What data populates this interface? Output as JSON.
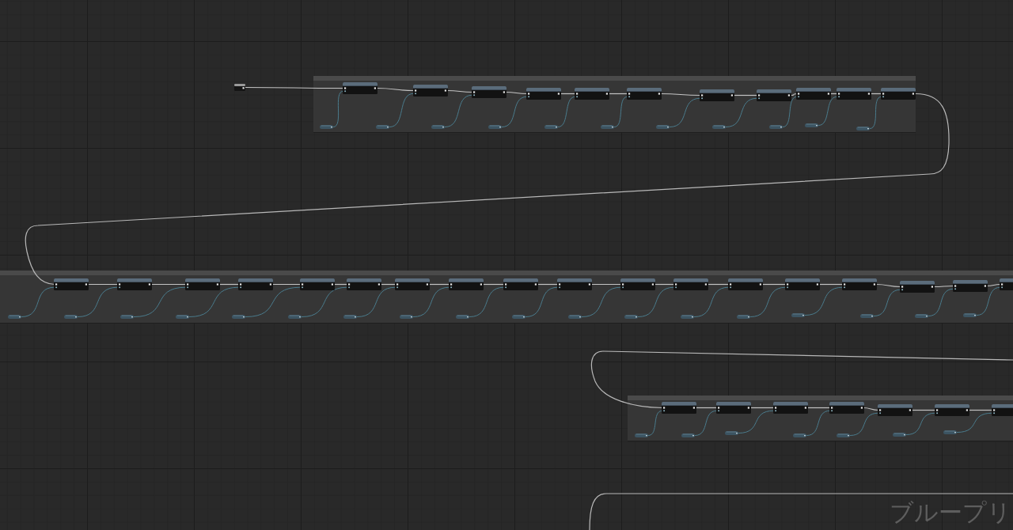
{
  "graph": {
    "type_label": "ブループリ"
  }
}
